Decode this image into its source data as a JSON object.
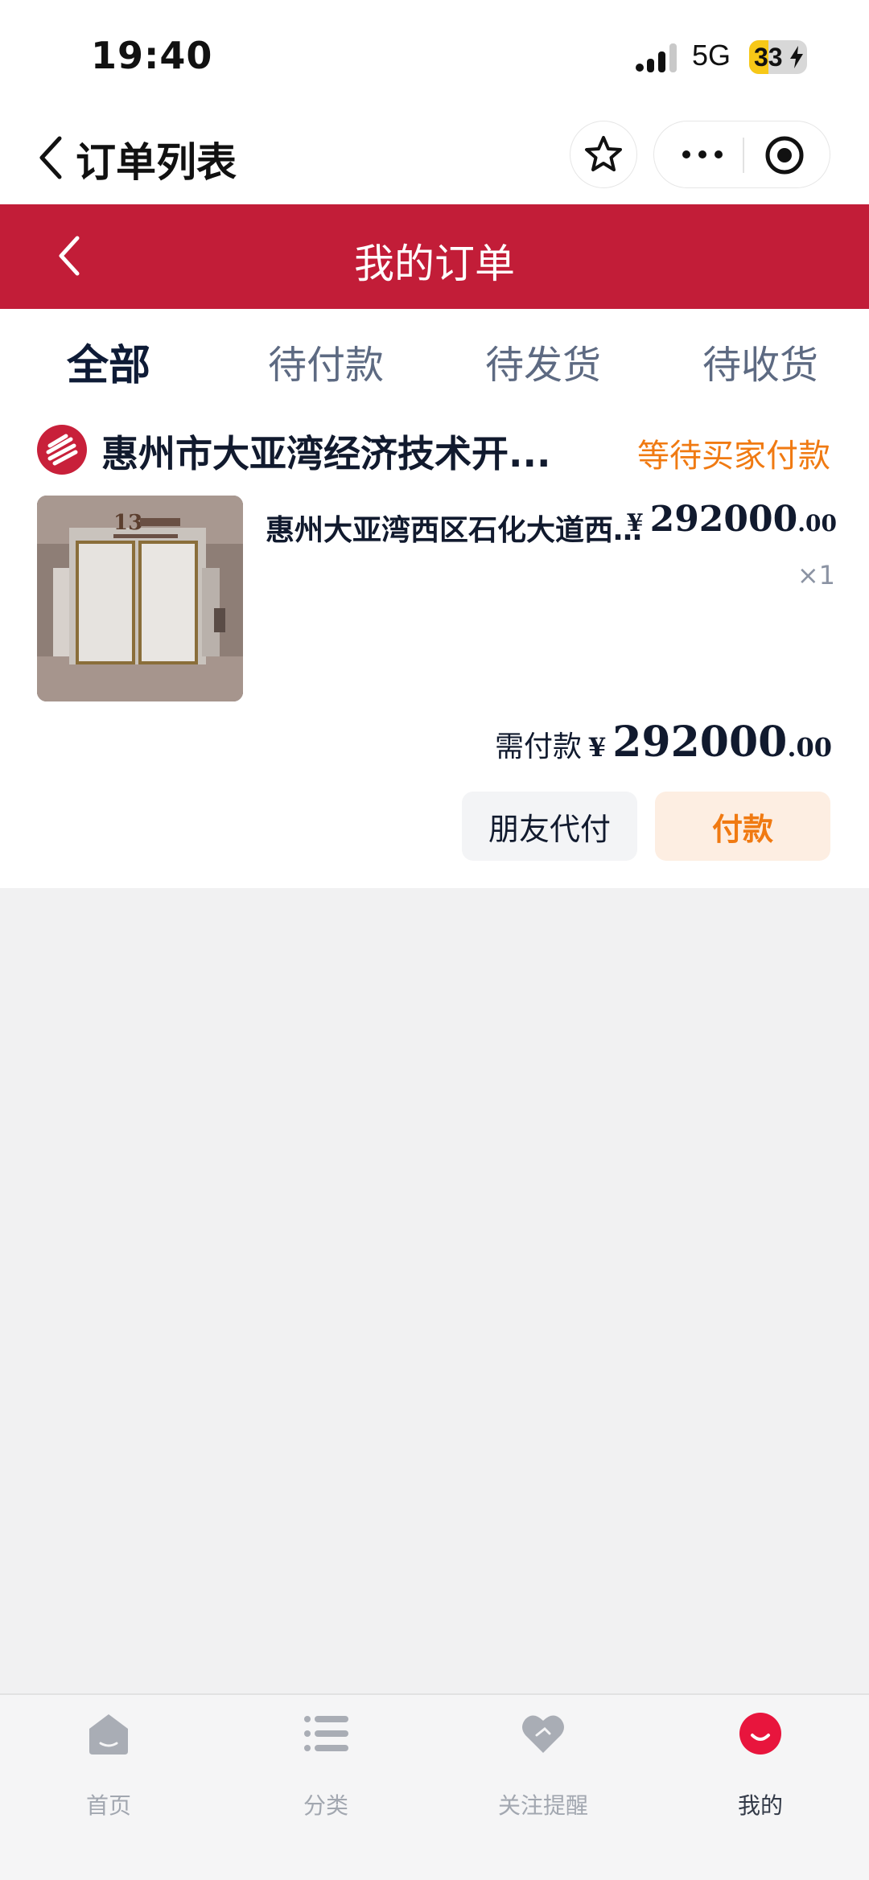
{
  "status_bar": {
    "time": "19:40",
    "network": "5G",
    "battery": "33"
  },
  "nav": {
    "title": "订单列表"
  },
  "header": {
    "title": "我的订单"
  },
  "tabs": [
    {
      "label": "全部",
      "active": true
    },
    {
      "label": "待付款",
      "active": false
    },
    {
      "label": "待发货",
      "active": false
    },
    {
      "label": "待收货",
      "active": false
    }
  ],
  "order": {
    "shop_name": "惠州市大亚湾经济技术开...",
    "status": "等待买家付款",
    "product_title": "惠州大亚湾西区石化大道西...",
    "price_currency": "¥",
    "price_int": "292000",
    "price_dec": ".00",
    "quantity": "×1",
    "total_label": "需付款",
    "total_currency": "¥",
    "total_int": "292000",
    "total_dec": ".00",
    "friend_pay_label": "朋友代付",
    "pay_label": "付款"
  },
  "tabbar": [
    {
      "label": "首页",
      "icon": "home-icon"
    },
    {
      "label": "分类",
      "icon": "list-icon"
    },
    {
      "label": "关注提醒",
      "icon": "heart-icon"
    },
    {
      "label": "我的",
      "icon": "profile-icon",
      "active": true
    }
  ],
  "colors": {
    "brand_red": "#c21d38",
    "status_orange": "#f07a12"
  }
}
